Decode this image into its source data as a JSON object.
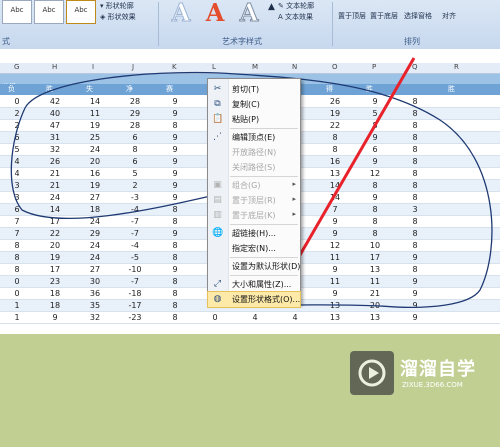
{
  "ribbon": {
    "shape_styles": [
      "Abc",
      "Abc",
      "Abc"
    ],
    "shape_outline": "形状轮廓",
    "shape_effects": "形状效果",
    "wordart_letters": [
      "A",
      "A",
      "A"
    ],
    "text_outline": "文本轮廓",
    "text_effects": "文本效果",
    "bring_front": "置于顶层",
    "send_back": "置于底层",
    "selection_pane": "选择窗格",
    "align": "对齐",
    "group_label_shape": "式",
    "group_label_wordart": "艺术字样式",
    "group_label_arrange": "排列"
  },
  "columns": [
    "G",
    "H",
    "I",
    "J",
    "K",
    "L",
    "M",
    "N",
    "O",
    "P",
    "Q",
    "R"
  ],
  "title_row": "总得",
  "header_row": [
    "负",
    "胜",
    "失",
    "净",
    "赛",
    "",
    "",
    "负",
    "得",
    "胜",
    "",
    "胜"
  ],
  "rows": [
    [
      "0",
      "42",
      "14",
      "28",
      "9",
      "",
      "",
      "0",
      "26",
      "9",
      "8",
      ""
    ],
    [
      "2",
      "40",
      "11",
      "29",
      "9",
      "",
      "",
      "0",
      "19",
      "5",
      "8",
      ""
    ],
    [
      "2",
      "47",
      "19",
      "28",
      "8",
      "",
      "",
      "2",
      "22",
      "8",
      "8",
      ""
    ],
    [
      "6",
      "31",
      "25",
      "6",
      "9",
      "",
      "",
      "3",
      "8",
      "9",
      "8",
      ""
    ],
    [
      "5",
      "32",
      "24",
      "8",
      "9",
      "",
      "",
      "1",
      "8",
      "6",
      "8",
      ""
    ],
    [
      "4",
      "26",
      "20",
      "6",
      "9",
      "",
      "",
      "1",
      "16",
      "9",
      "8",
      ""
    ],
    [
      "4",
      "21",
      "16",
      "5",
      "9",
      "",
      "",
      "0",
      "13",
      "12",
      "8",
      ""
    ],
    [
      "3",
      "21",
      "19",
      "2",
      "9",
      "",
      "",
      "2",
      "14",
      "8",
      "8",
      ""
    ],
    [
      "3",
      "24",
      "27",
      "-3",
      "9",
      "",
      "",
      "1",
      "14",
      "9",
      "8",
      ""
    ],
    [
      "6",
      "14",
      "18",
      "-4",
      "8",
      "",
      "",
      "6",
      "7",
      "8",
      "3",
      ""
    ],
    [
      "7",
      "17",
      "24",
      "-7",
      "8",
      "",
      "",
      "5",
      "9",
      "8",
      "8",
      ""
    ],
    [
      "7",
      "22",
      "29",
      "-7",
      "9",
      "",
      "",
      "3",
      "9",
      "8",
      "8",
      ""
    ],
    [
      "8",
      "20",
      "24",
      "-4",
      "8",
      "",
      "",
      "2",
      "12",
      "10",
      "8",
      ""
    ],
    [
      "8",
      "19",
      "24",
      "-5",
      "8",
      "",
      "",
      "5",
      "11",
      "17",
      "9",
      ""
    ],
    [
      "8",
      "17",
      "27",
      "-10",
      "9",
      "",
      "",
      "3",
      "9",
      "13",
      "8",
      ""
    ],
    [
      "0",
      "23",
      "30",
      "-7",
      "8",
      "",
      "",
      "3",
      "11",
      "11",
      "9",
      ""
    ],
    [
      "0",
      "18",
      "36",
      "-18",
      "8",
      "",
      "",
      "6",
      "9",
      "21",
      "9",
      ""
    ],
    [
      "1",
      "18",
      "35",
      "-17",
      "8",
      "2",
      "1",
      "5",
      "13",
      "20",
      "9",
      ""
    ],
    [
      "1",
      "9",
      "32",
      "-23",
      "8",
      "0",
      "4",
      "4",
      "13",
      "13",
      "9",
      ""
    ]
  ],
  "context_menu": [
    {
      "icon": "scissors-icon",
      "glyph": "✂",
      "label": "剪切(T)",
      "disabled": false
    },
    {
      "icon": "copy-icon",
      "glyph": "⧉",
      "label": "复制(C)",
      "disabled": false
    },
    {
      "icon": "paste-icon",
      "glyph": "📋",
      "label": "粘贴(P)",
      "disabled": false
    },
    {
      "icon": "edit-points-icon",
      "glyph": "⋰",
      "label": "编辑顶点(E)",
      "disabled": false
    },
    {
      "icon": "open-path-icon",
      "glyph": "",
      "label": "开放路径(N)",
      "disabled": true
    },
    {
      "icon": "close-path-icon",
      "glyph": "",
      "label": "关闭路径(S)",
      "disabled": true
    },
    {
      "icon": "group-icon",
      "glyph": "▣",
      "label": "组合(G)",
      "disabled": true
    },
    {
      "icon": "bring-front-icon",
      "glyph": "▤",
      "label": "置于顶层(R)",
      "disabled": true
    },
    {
      "icon": "send-back-icon",
      "glyph": "▥",
      "label": "置于底层(K)",
      "disabled": true
    },
    {
      "icon": "hyperlink-icon",
      "glyph": "🌐",
      "label": "超链接(H)...",
      "disabled": false
    },
    {
      "icon": "assign-macro-icon",
      "glyph": "",
      "label": "指定宏(N)...",
      "disabled": false
    },
    {
      "icon": "set-default-icon",
      "glyph": "",
      "label": "设置为默认形状(D)",
      "disabled": false
    },
    {
      "icon": "size-properties-icon",
      "glyph": "⤢",
      "label": "大小和属性(Z)...",
      "disabled": false
    },
    {
      "icon": "format-shape-icon",
      "glyph": "◍",
      "label": "设置形状格式(O)...",
      "disabled": false
    }
  ],
  "logo": {
    "main": "溜溜自学",
    "sub": "ZIXUE.3D66.COM"
  },
  "colors": {
    "arrow": "#e8212b",
    "annotation_stroke": "#1f3a73",
    "header_blue": "#6fa3d6"
  }
}
